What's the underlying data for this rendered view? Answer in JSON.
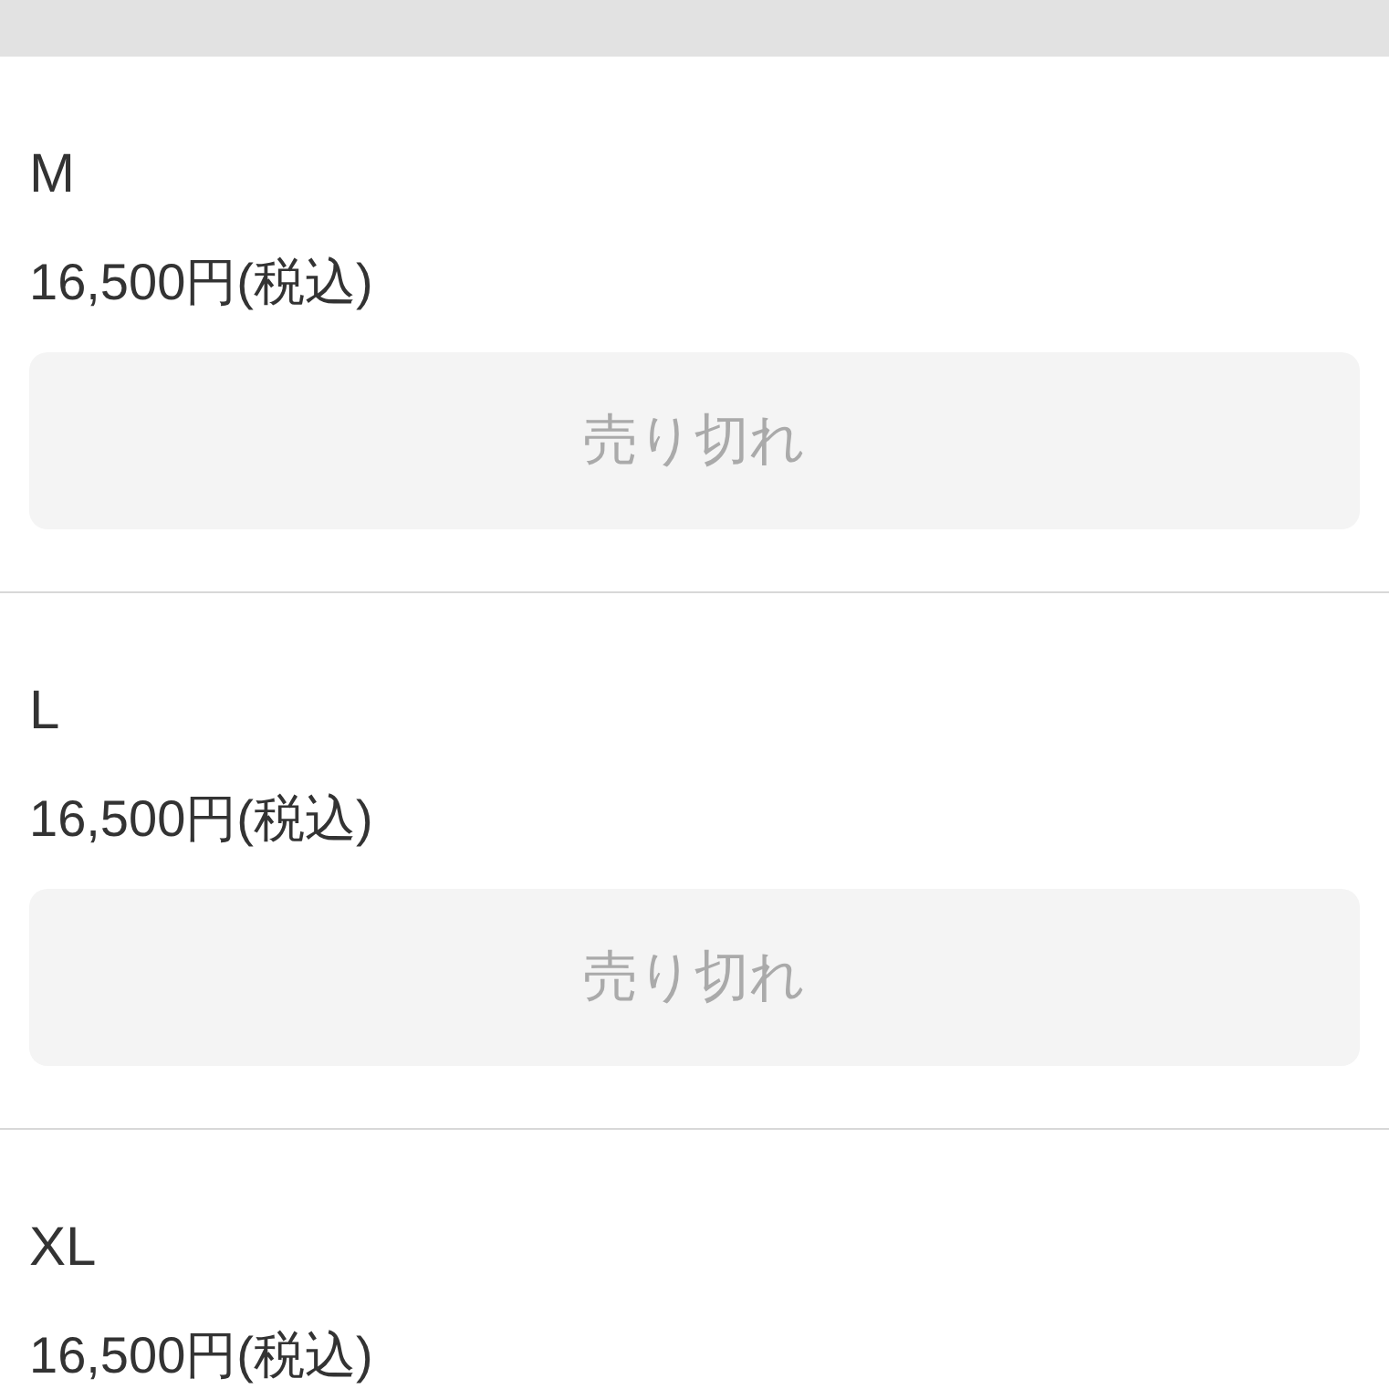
{
  "variants": [
    {
      "size": "M",
      "price": "16,500円(税込)",
      "button": {
        "label": "売り切れ",
        "disabled": true
      }
    },
    {
      "size": "L",
      "price": "16,500円(税込)",
      "button": {
        "label": "売り切れ",
        "disabled": true
      }
    },
    {
      "size": "XL",
      "price": "16,500円(税込)"
    }
  ]
}
